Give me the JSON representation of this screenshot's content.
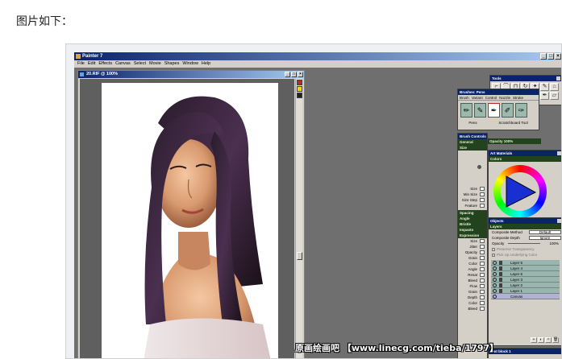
{
  "caption": "图片如下：",
  "app": {
    "title": "Painter 7",
    "menu": [
      "File",
      "Edit",
      "Effects",
      "Canvas",
      "Select",
      "Movie",
      "Shapes",
      "Window",
      "Help"
    ]
  },
  "document": {
    "title": "20.RIF @ 100%"
  },
  "tools_panel": {
    "title": "Tools"
  },
  "brushes_panel": {
    "title": "Brushes: Pens",
    "menu": [
      "Brush",
      "Variant",
      "Control",
      "Nozzle",
      "Stroke"
    ],
    "footer_left": "Pens",
    "footer_right": "Scratchboard Tool"
  },
  "brush_controls": {
    "title": "Brush Controls",
    "general": "General",
    "opacity": "Opacity 100%",
    "size": "Size",
    "size_labels": [
      "Size",
      "Min Size",
      "Size Step",
      "Feature"
    ],
    "sections": [
      "Spacing",
      "Angle",
      "Bristle",
      "Impasto",
      "Expression"
    ],
    "expression_labels": [
      "Size",
      "Jitter",
      "Opacity",
      "Grain",
      "Color",
      "Angle",
      "Resat",
      "Bleed",
      "Flow",
      "Grain",
      "Depth",
      "Color",
      "Bleed"
    ]
  },
  "art_materials": {
    "title": "Art Materials",
    "colors": "Colors"
  },
  "objects": {
    "title": "Objects",
    "layers": "Layers",
    "composite_method_label": "Composite Method",
    "composite_method_value": "Default",
    "composite_depth_label": "Composite Depth",
    "composite_depth_value": "Ignore",
    "opacity_label": "Opacity",
    "opacity_value": "100%",
    "preserve": "Preserve Transparency",
    "pick_up": "Pick Up Underlying Color",
    "layer_names": [
      "Layer 5",
      "Layer 4",
      "Layer 6",
      "Layer 3",
      "Layer 2",
      "Layer 1",
      "Canvas"
    ],
    "bottom_title": "Text block 1"
  },
  "watermark": "原画绘画吧  【www.linecg.com/tieba/1797】",
  "colors": {
    "title_bar": "#0a246a",
    "section_bar": "#23431f",
    "layer_row": "#9ab4ae",
    "selected_layer": "#b4b0d4"
  }
}
